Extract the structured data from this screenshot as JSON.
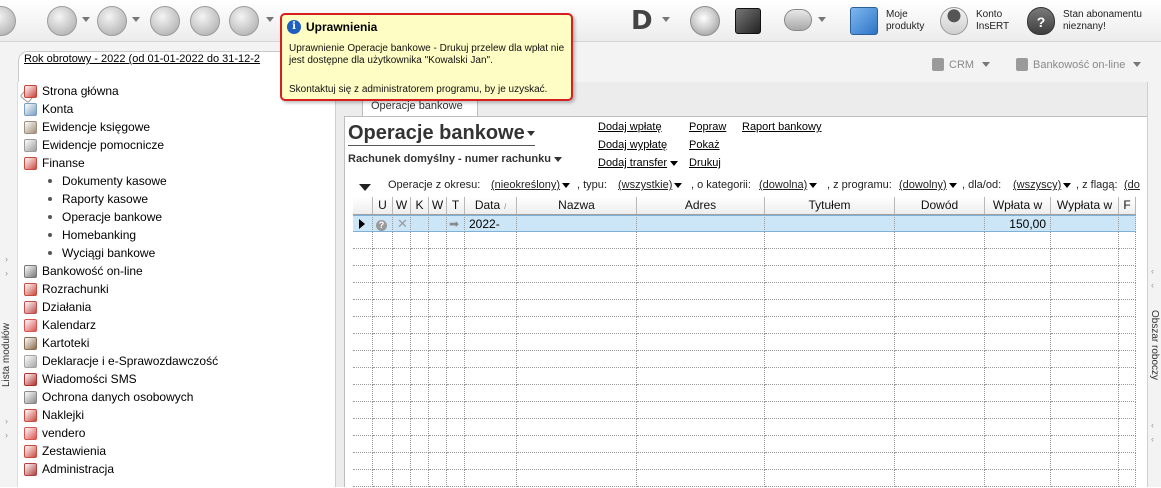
{
  "toolbar": {
    "brand_letter": "D",
    "products_label_1": "Moje",
    "products_label_2": "produkty",
    "account_label_1": "Konto",
    "account_label_2": "InsERT",
    "subscription_label_1": "Stan abonamentu",
    "subscription_label_2": "nieznany!"
  },
  "header": {
    "period": "Rok obrotowy - 2022  (od 01-01-2022 do 31-12-2",
    "crm": "CRM",
    "online_banking": "Bankowość on-line"
  },
  "sidebar": {
    "vertical_label": "Lista modułów",
    "items": [
      {
        "label": "Strona główna",
        "icon": "home-icon",
        "color": "#c8413a"
      },
      {
        "label": "Konta",
        "icon": "accounts-icon",
        "color": "#7a9fc2"
      },
      {
        "label": "Ewidencje księgowe",
        "icon": "ledger-icon",
        "color": "#9f8f7a"
      },
      {
        "label": "Ewidencje pomocnicze",
        "icon": "auxiliary-icon",
        "color": "#9c9c9c"
      },
      {
        "label": "Finanse",
        "icon": "finance-icon",
        "color": "#c94a3f"
      },
      {
        "label": "Dokumenty kasowe",
        "sub": true
      },
      {
        "label": "Raporty kasowe",
        "sub": true
      },
      {
        "label": "Operacje bankowe",
        "sub": true
      },
      {
        "label": "Homebanking",
        "sub": true
      },
      {
        "label": "Wyciągi bankowe",
        "sub": true
      },
      {
        "label": "Bankowość on-line",
        "icon": "online-bank-icon",
        "color": "#777777"
      },
      {
        "label": "Rozrachunki",
        "icon": "settlements-icon",
        "color": "#c94a3f"
      },
      {
        "label": "Działania",
        "icon": "actions-icon",
        "color": "#c0504d"
      },
      {
        "label": "Kalendarz",
        "icon": "calendar-icon",
        "color": "#d9534f"
      },
      {
        "label": "Kartoteki",
        "icon": "files-icon",
        "color": "#8b6b4f"
      },
      {
        "label": "Deklaracje i e-Sprawozdawczość",
        "icon": "declarations-icon",
        "color": "#a5a5a5"
      },
      {
        "label": "Wiadomości SMS",
        "icon": "sms-icon",
        "color": "#b03030"
      },
      {
        "label": "Ochrona danych osobowych",
        "icon": "privacy-icon",
        "color": "#8a8a8a"
      },
      {
        "label": "Naklejki",
        "icon": "stickers-icon",
        "color": "#c94a3f"
      },
      {
        "label": "vendero",
        "icon": "vendero-icon",
        "color": "#d9534f"
      },
      {
        "label": "Zestawienia",
        "icon": "reports-icon",
        "color": "#c94a3f"
      },
      {
        "label": "Administracja",
        "icon": "admin-icon",
        "color": "#b0413e"
      }
    ]
  },
  "main": {
    "tab_label": "Operacje bankowe",
    "title": "Operacje bankowe",
    "account": "Rachunek domyślny - numer rachunku",
    "actions": {
      "add_deposit": "Dodaj wpłatę",
      "add_withdrawal": "Dodaj wypłatę",
      "add_transfer": "Dodaj transfer",
      "edit": "Popraw",
      "show": "Pokaż",
      "print": "Drukuj",
      "bank_report": "Raport bankowy"
    },
    "filters": {
      "period_label": "Operacje z okresu:",
      "period_value": "(nieokreślony)",
      "type_label": ", typu:",
      "type_value": "(wszystkie)",
      "category_label": ", o kategorii:",
      "category_value": "(dowolna)",
      "program_label": ", z programu:",
      "program_value": "(dowolny)",
      "party_label": ", dla/od:",
      "party_value": "(wszyscy)",
      "flag_label": ", z flagą:",
      "flag_value": "(do"
    },
    "columns": [
      "U",
      "W",
      "K",
      "W",
      "T",
      "Data",
      "Nazwa",
      "Adres",
      "Tytułem",
      "Dowód",
      "Wpłata w",
      "Wypłata w",
      "F"
    ],
    "rows": [
      {
        "date": "2022-",
        "name": "",
        "address": "",
        "title": "",
        "doc": "",
        "deposit": "150,00",
        "withdrawal": ""
      }
    ]
  },
  "right_panel": {
    "vertical_label": "Obszar roboczy"
  },
  "tooltip": {
    "title": "Uprawnienia",
    "message": "Uprawnienie Operacje bankowe - Drukuj przelew dla wpłat nie jest dostępne dla użytkownika \"Kowalski Jan\".",
    "contact": "Skontaktuj się z administratorem programu, by je uzyskać."
  }
}
